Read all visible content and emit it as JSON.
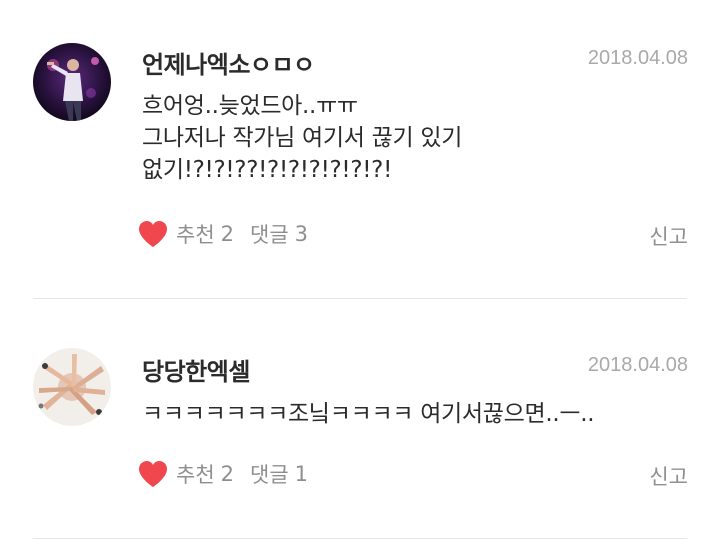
{
  "comments": [
    {
      "author": "언제나엑소ㅇㅁㅇ",
      "date": "2018.04.08",
      "body_lines": [
        "흐어엉..늦었드아..ㅠㅠ",
        "그나저나 작가님 여기서 끊기 있기",
        "없기!?!?!??!?!?!?!?!?!?!"
      ],
      "like_label": "추천",
      "like_count": "2",
      "reply_label": "댓글",
      "reply_count": "3",
      "report_label": "신고",
      "avatar_icon": "concert-photo-avatar"
    },
    {
      "author": "당당한엑셀",
      "date": "2018.04.08",
      "body_lines": [
        "ㅋㅋㅋㅋㅋㅋㅋ조닠ㅋㅋㅋㅋ 여기서끊으면..ㅡ.."
      ],
      "like_label": "추천",
      "like_count": "2",
      "reply_label": "댓글",
      "reply_count": "1",
      "report_label": "신고",
      "avatar_icon": "hands-photo-avatar"
    }
  ],
  "colors": {
    "heart": "#f0464d",
    "text": "#2b2b2b",
    "muted": "#8f8f8f",
    "date": "#a9a9a9",
    "divider": "#e6e6e6"
  }
}
